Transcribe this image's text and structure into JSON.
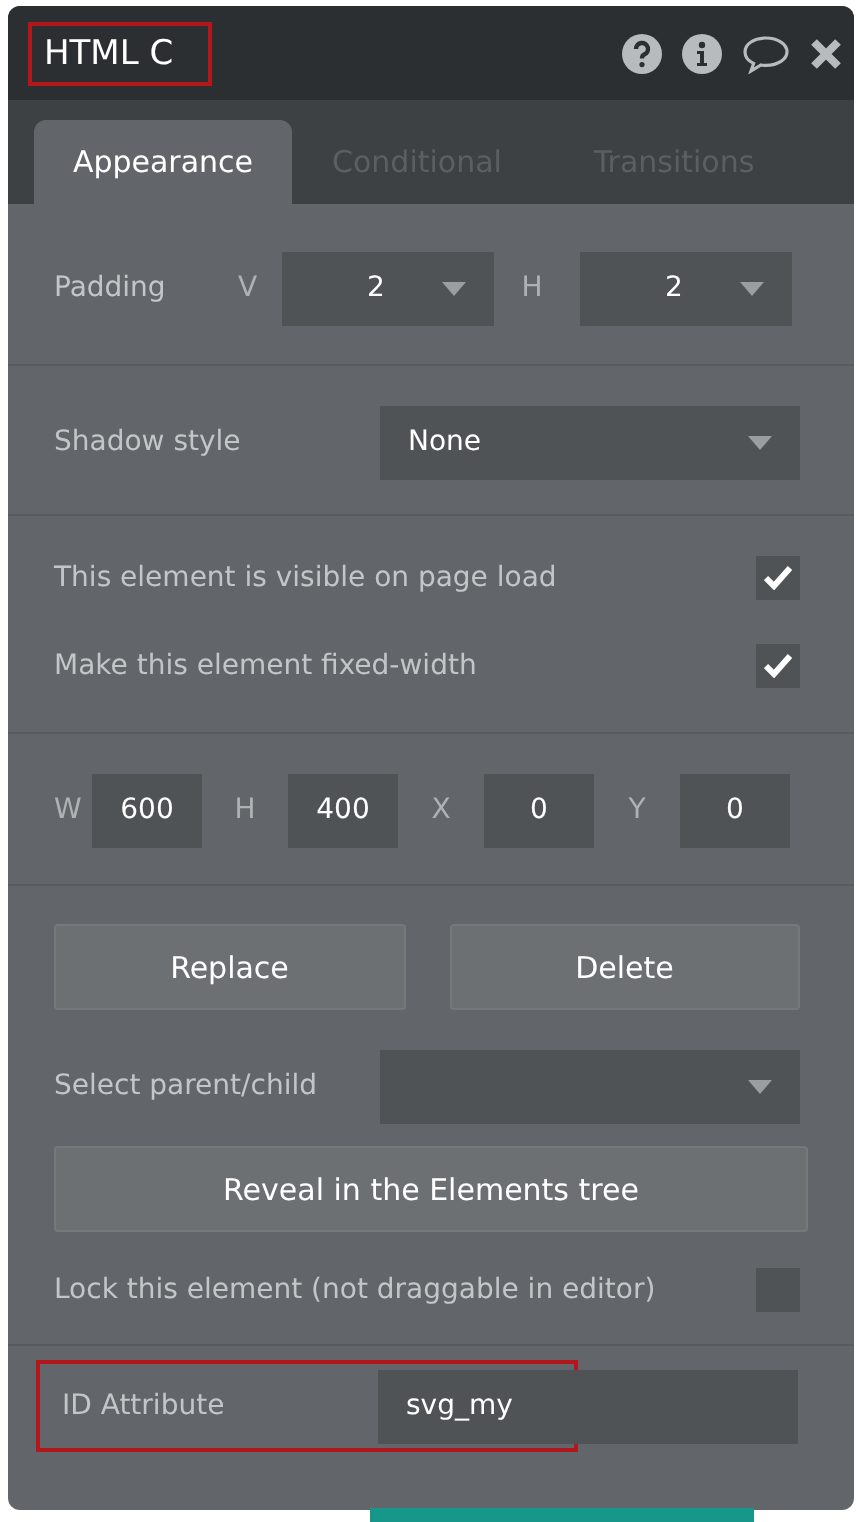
{
  "header": {
    "title": "HTML C",
    "highlighted": true
  },
  "tabs": [
    {
      "label": "Appearance",
      "selected": true
    },
    {
      "label": "Conditional",
      "selected": false
    },
    {
      "label": "Transitions",
      "selected": false
    }
  ],
  "padding": {
    "label": "Padding",
    "fields": [
      {
        "label": "V",
        "value": "2"
      },
      {
        "label": "H",
        "value": "2"
      }
    ]
  },
  "shadow": {
    "label": "Shadow style",
    "value": "None"
  },
  "checkboxes": [
    {
      "label": "This element is visible on page load",
      "checked": true
    },
    {
      "label": "Make this element fixed-width",
      "checked": true
    }
  ],
  "geometry": [
    {
      "label": "W",
      "value": "600"
    },
    {
      "label": "H",
      "value": "400"
    },
    {
      "label": "X",
      "value": "0"
    },
    {
      "label": "Y",
      "value": "0"
    }
  ],
  "buttons": [
    "Replace",
    "Delete"
  ],
  "select_parent": {
    "label": "Select parent/child"
  },
  "reveal_button": "Reveal in the Elements tree",
  "lock": {
    "label": "Lock this element (not draggable in editor)",
    "checked": false
  },
  "id_attribute": {
    "label": "ID Attribute",
    "value": "svg_my",
    "highlighted": true
  }
}
